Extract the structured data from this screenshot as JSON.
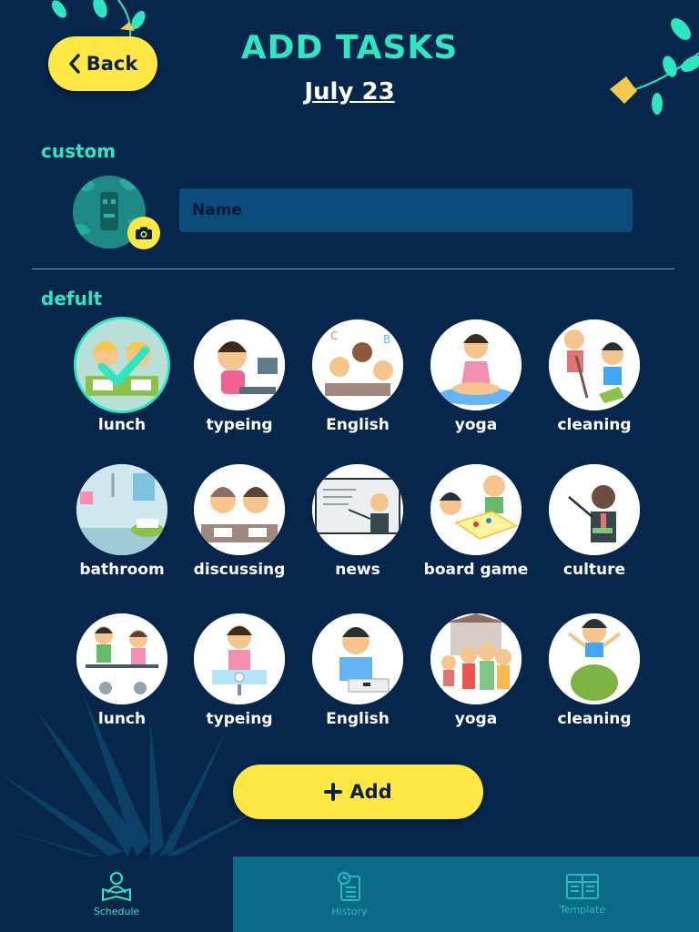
{
  "header": {
    "back_label": "Back",
    "title": "ADD TASKS",
    "date": "July 23"
  },
  "custom": {
    "section_label": "custom",
    "name_placeholder": "Name",
    "name_value": ""
  },
  "defaults": {
    "section_label": "defult",
    "tasks": [
      {
        "label": "lunch",
        "selected": true
      },
      {
        "label": "typeing",
        "selected": false
      },
      {
        "label": "English",
        "selected": false
      },
      {
        "label": "yoga",
        "selected": false
      },
      {
        "label": "cleaning",
        "selected": false
      },
      {
        "label": "bathroom",
        "selected": false
      },
      {
        "label": "discussing",
        "selected": false
      },
      {
        "label": "news",
        "selected": false
      },
      {
        "label": "board game",
        "selected": false
      },
      {
        "label": "culture",
        "selected": false
      },
      {
        "label": "lunch",
        "selected": false
      },
      {
        "label": "typeing",
        "selected": false
      },
      {
        "label": "English",
        "selected": false
      },
      {
        "label": "yoga",
        "selected": false
      },
      {
        "label": "cleaning",
        "selected": false
      }
    ]
  },
  "actions": {
    "add_label": "Add"
  },
  "tabs": [
    {
      "label": "Schedule",
      "icon": "reading-person-icon",
      "active": true
    },
    {
      "label": "History",
      "icon": "clock-document-icon",
      "active": false
    },
    {
      "label": "Template",
      "icon": "template-grid-icon",
      "active": false
    }
  ],
  "colors": {
    "background": "#06264c",
    "accent": "#2ee7c2",
    "button": "#ffe844",
    "input": "#0b4c7c",
    "tab_inactive": "#0b6a86"
  }
}
